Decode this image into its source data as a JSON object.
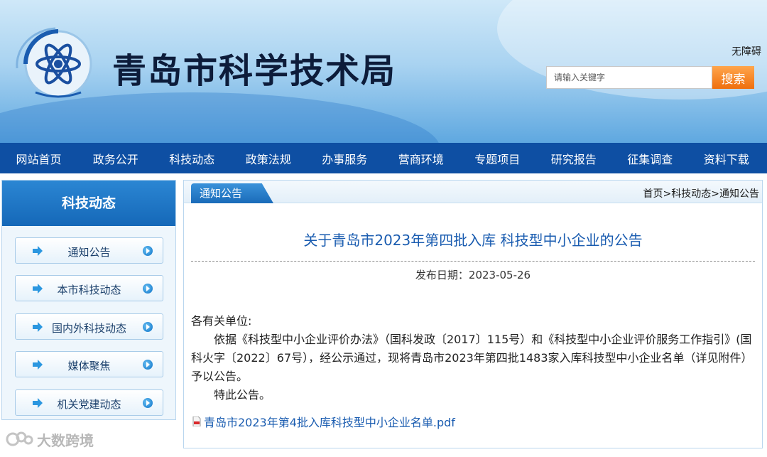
{
  "header": {
    "site_title": "青岛市科学技术局",
    "accessibility": "无障碍",
    "search_placeholder": "请输入关键字",
    "search_button": "搜索"
  },
  "nav": [
    "网站首页",
    "政务公开",
    "科技动态",
    "政策法规",
    "办事服务",
    "营商环境",
    "专题项目",
    "研究报告",
    "征集调查",
    "资料下载"
  ],
  "sidebar": {
    "title": "科技动态",
    "items": [
      "通知公告",
      "本市科技动态",
      "国内外科技动态",
      "媒体聚焦",
      "机关党建动态"
    ]
  },
  "content": {
    "tab": "通知公告",
    "breadcrumb": "首页>科技动态>通知公告",
    "title": "关于青岛市2023年第四批入库 科技型中小企业的公告",
    "date_label": "发布日期：",
    "date": "2023-05-26",
    "salutation": "各有关单位:",
    "paragraph": "依据《科技型中小企业评价办法》（国科发政〔2017〕115号）和《科技型中小企业评价服务工作指引》(国科火字〔2022〕67号），经公示通过，现将青岛市2023年第四批1483家入库科技型中小企业名单（详见附件）予以公告。",
    "closing": "特此公告。",
    "attachment": "青岛市2023年第4批入库科技型中小企业名单.pdf"
  },
  "watermark": "大数跨境",
  "colors": {
    "nav_bg": "#0e4fa3",
    "accent_blue": "#1a5cb0",
    "search_orange": "#ef6f0d"
  }
}
